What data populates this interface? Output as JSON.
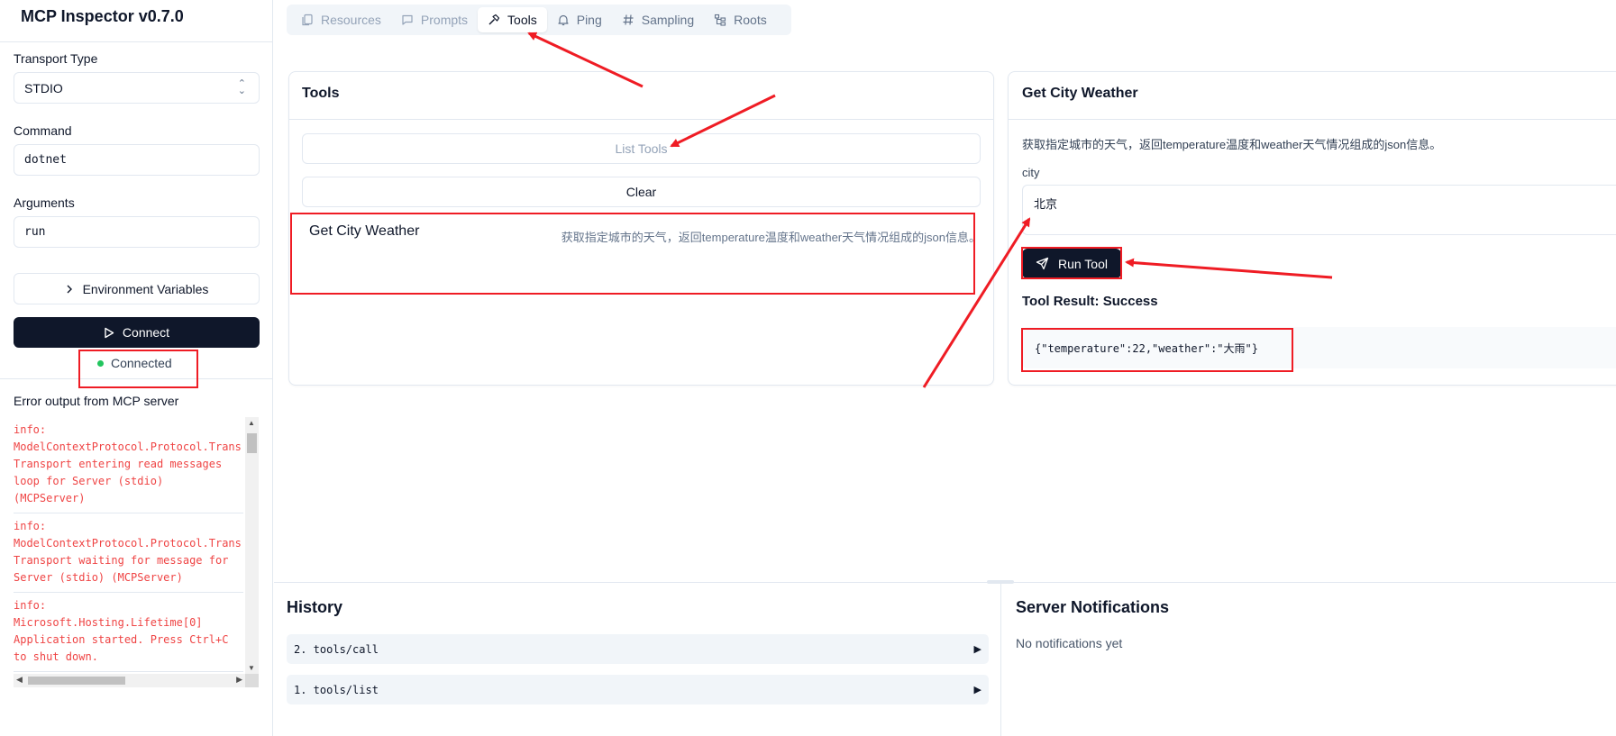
{
  "app": {
    "title": "MCP Inspector v0.7.0"
  },
  "sidebar": {
    "transport_label": "Transport Type",
    "transport_value": "STDIO",
    "command_label": "Command",
    "command_value": "dotnet",
    "arguments_label": "Arguments",
    "arguments_value": "run",
    "env_button": "Environment Variables",
    "connect_button": "Connect",
    "status": "Connected",
    "error_output_title": "Error output from MCP server",
    "log_entries": [
      "info:\nModelContextProtocol.Protocol.Trans\nTransport entering read messages\nloop for Server (stdio)\n(MCPServer)",
      "info:\nModelContextProtocol.Protocol.Trans\nTransport waiting for message for\nServer (stdio) (MCPServer)",
      "info:\nMicrosoft.Hosting.Lifetime[0]\nApplication started. Press Ctrl+C\nto shut down."
    ]
  },
  "tabs": [
    {
      "label": "Resources",
      "icon": "files-icon",
      "state": "disabled"
    },
    {
      "label": "Prompts",
      "icon": "message-square-icon",
      "state": "disabled"
    },
    {
      "label": "Tools",
      "icon": "hammer-icon",
      "state": "active"
    },
    {
      "label": "Ping",
      "icon": "bell-icon",
      "state": "enabled"
    },
    {
      "label": "Sampling",
      "icon": "hash-icon",
      "state": "enabled"
    },
    {
      "label": "Roots",
      "icon": "folder-tree-icon",
      "state": "enabled"
    }
  ],
  "tools_panel": {
    "title": "Tools",
    "list_button": "List Tools",
    "clear_button": "Clear",
    "items": [
      {
        "name": "Get City Weather",
        "description": "获取指定城市的天气，返回temperature温度和weather天气情况组成的json信息。"
      }
    ]
  },
  "tool_detail": {
    "title": "Get City Weather",
    "description": "获取指定城市的天气，返回temperature温度和weather天气情况组成的json信息。",
    "param_label": "city",
    "param_value": "北京",
    "run_button": "Run Tool",
    "result_title": "Tool Result: Success",
    "result_json": "{\"temperature\":22,\"weather\":\"大雨\"}"
  },
  "history": {
    "title": "History",
    "items": [
      {
        "label": "2. tools/call"
      },
      {
        "label": "1. tools/list"
      }
    ]
  },
  "notifications": {
    "title": "Server Notifications",
    "empty_text": "No notifications yet"
  },
  "colors": {
    "primary_dark": "#0f172a",
    "annotation_red": "#ef1c24",
    "status_green": "#22c55e",
    "log_red": "#ef4444"
  }
}
